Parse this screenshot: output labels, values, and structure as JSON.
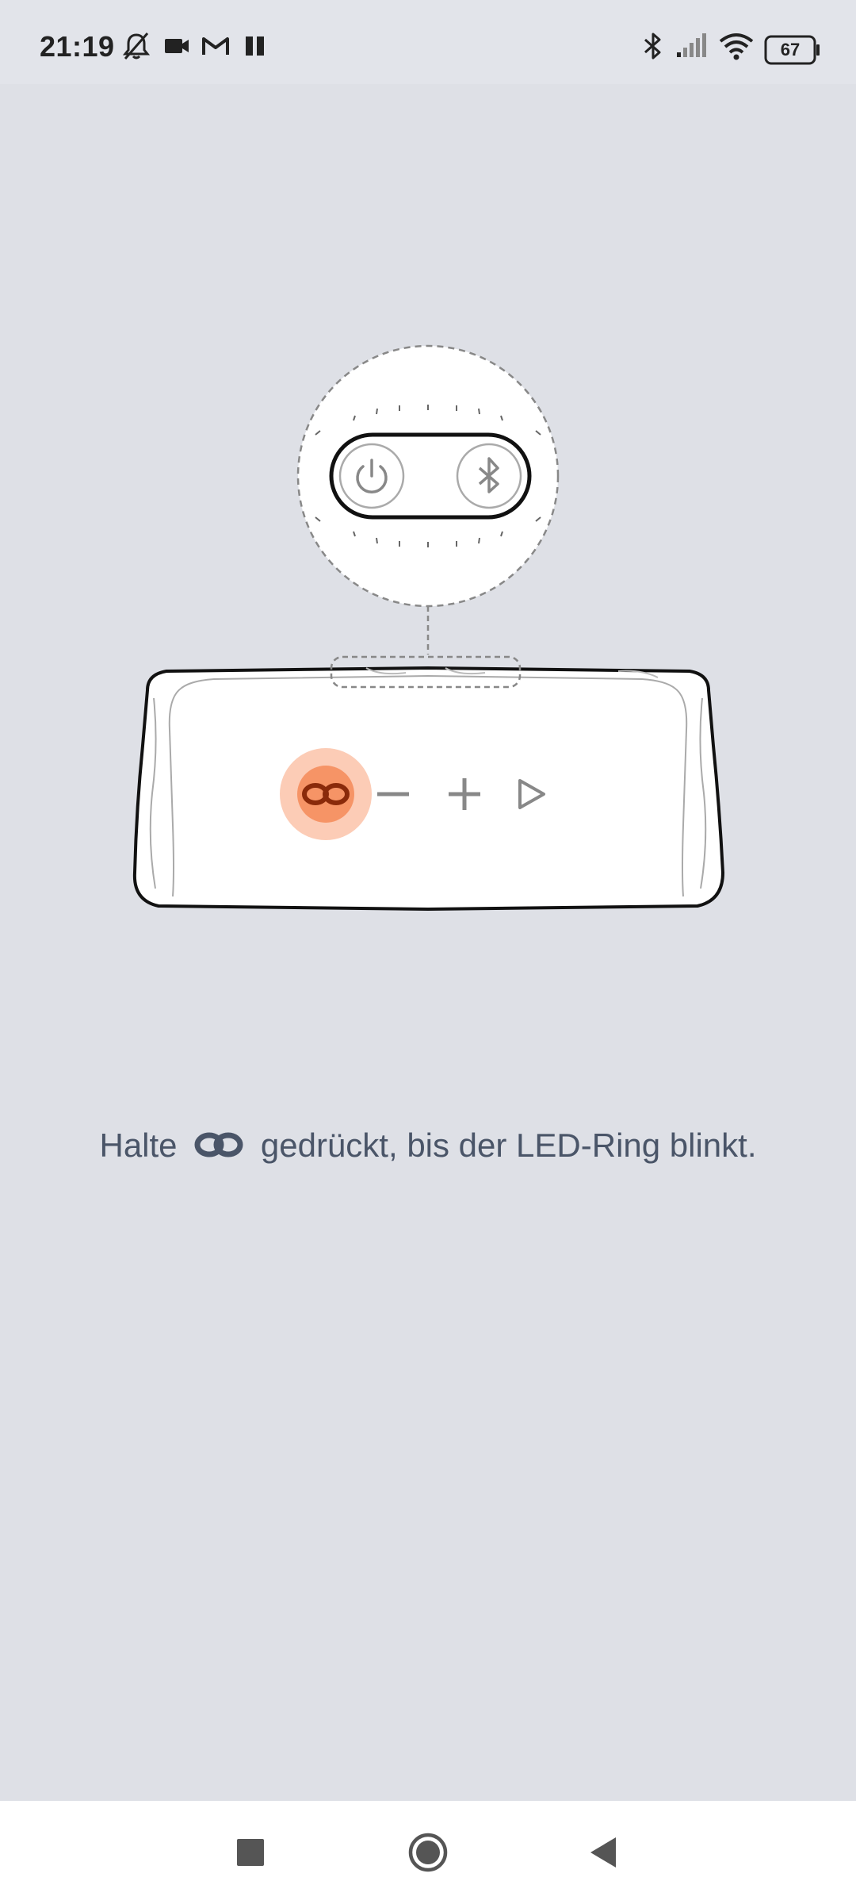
{
  "status_bar": {
    "time": "21:19",
    "battery": "67",
    "left_icons": [
      "bell-off-icon",
      "video-camera-icon",
      "gmail-icon",
      "pause-icon"
    ],
    "right_icons": [
      "bluetooth-icon",
      "signal-icon",
      "wifi-icon",
      "battery-icon"
    ]
  },
  "illustration": {
    "callout_buttons": [
      "power-icon",
      "bluetooth-icon"
    ],
    "speaker_buttons": [
      "partyboost-link-icon",
      "minus-icon",
      "plus-icon",
      "play-icon"
    ],
    "highlight_color": "#f9a27a",
    "highlight_inner_color": "#f58a58",
    "link_icon_color": "#8a2a0a"
  },
  "instruction": {
    "before": "Halte",
    "icon": "link-icon",
    "after": "gedrückt, bis der LED-Ring blinkt."
  },
  "nav_bar": {
    "buttons": [
      "recents-button",
      "home-button",
      "back-button"
    ]
  }
}
